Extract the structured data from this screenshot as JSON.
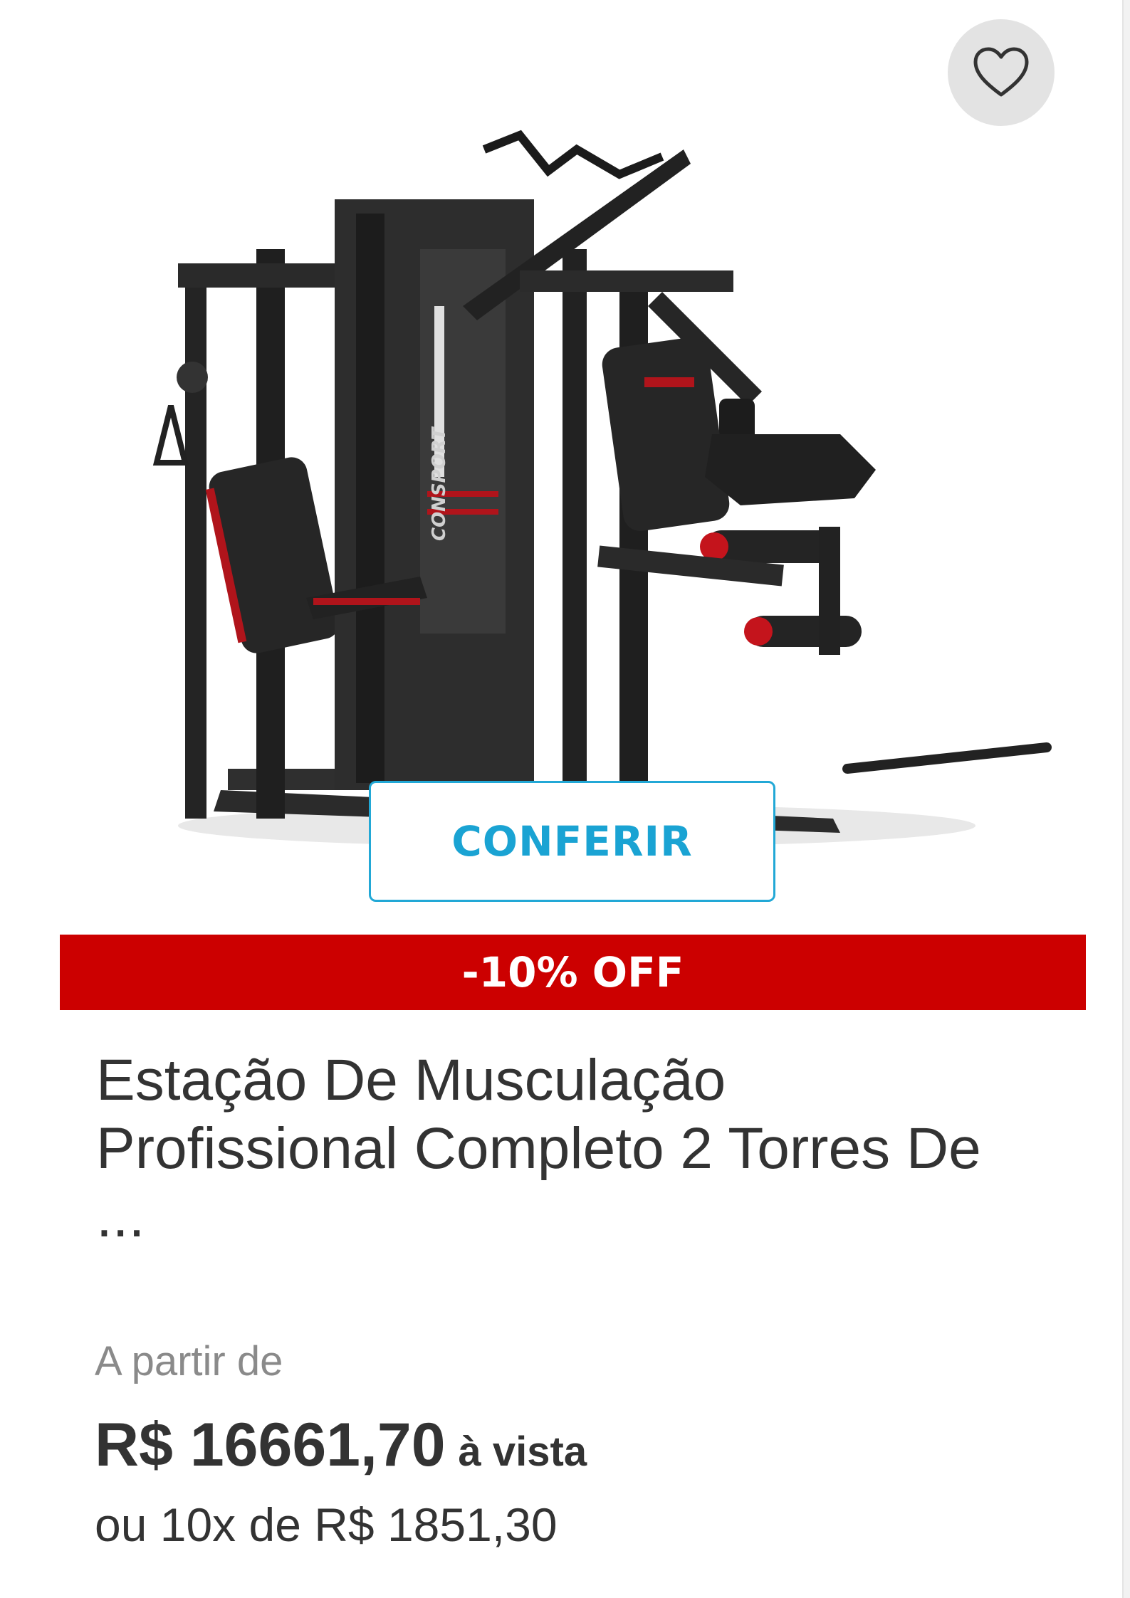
{
  "card": {
    "wishlist_icon": "heart-outline-icon",
    "product_image_alt": "CONSPORT",
    "cta_label": "CONFERIR",
    "discount_label": "-10% OFF",
    "title": "Estação De Musculação Profissional Completo 2 Torres De ...",
    "price_prefix": "A partir de",
    "price": "R$ 16661,70",
    "price_suffix": "à vista",
    "installments": "ou 10x de R$ 1851,30"
  },
  "colors": {
    "accent_blue": "#1aa3d3",
    "discount_red": "#cc0000",
    "text_dark": "#333333",
    "text_muted": "#8a8a8a",
    "wishlist_bg": "#e3e3e3"
  }
}
